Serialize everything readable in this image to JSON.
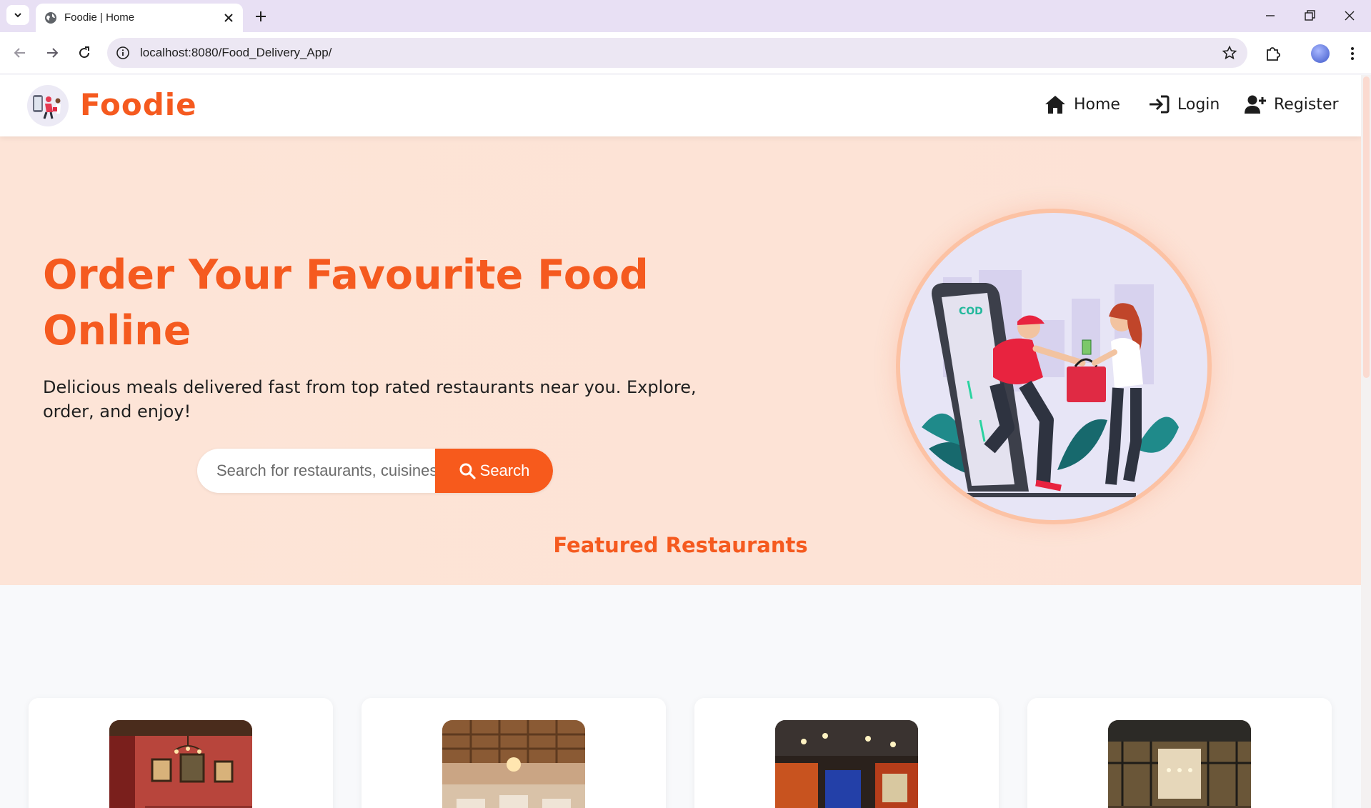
{
  "browser": {
    "tab_title": "Foodie | Home",
    "url": "localhost:8080/Food_Delivery_App/",
    "icons": [
      "tab-list-icon",
      "globe-icon",
      "close-icon",
      "plus-icon",
      "minimize-icon",
      "restore-icon",
      "close-window-icon",
      "back-arrow-icon",
      "forward-arrow-icon",
      "reload-icon",
      "site-info-icon",
      "star-icon",
      "extensions-icon",
      "profile-avatar",
      "more-menu-icon"
    ]
  },
  "header": {
    "brand": "Foodie",
    "nav": [
      {
        "label": "Home",
        "icon": "home-icon"
      },
      {
        "label": "Login",
        "icon": "login-icon"
      },
      {
        "label": "Register",
        "icon": "user-plus-icon"
      }
    ]
  },
  "hero": {
    "title": "Order Your Favourite Food Online",
    "subtitle": "Delicious meals delivered fast from top rated restaurants near you. Explore, order, and enjoy!",
    "search_placeholder": "Search for restaurants, cuisines...",
    "search_button": "Search",
    "illustration_label": "COD"
  },
  "featured": {
    "title": "Featured Restaurants",
    "restaurants": [
      {
        "image": "restaurant-interior-red-walls"
      },
      {
        "image": "restaurant-interior-ornate-ceiling"
      },
      {
        "image": "restaurant-interior-dark-lights"
      },
      {
        "image": "restaurant-interior-hall"
      }
    ]
  },
  "colors": {
    "brand": "#f55a1f",
    "hero_bg": "#fde3d6",
    "page_bg": "#f8f9fb",
    "button": "#f75a1c"
  }
}
